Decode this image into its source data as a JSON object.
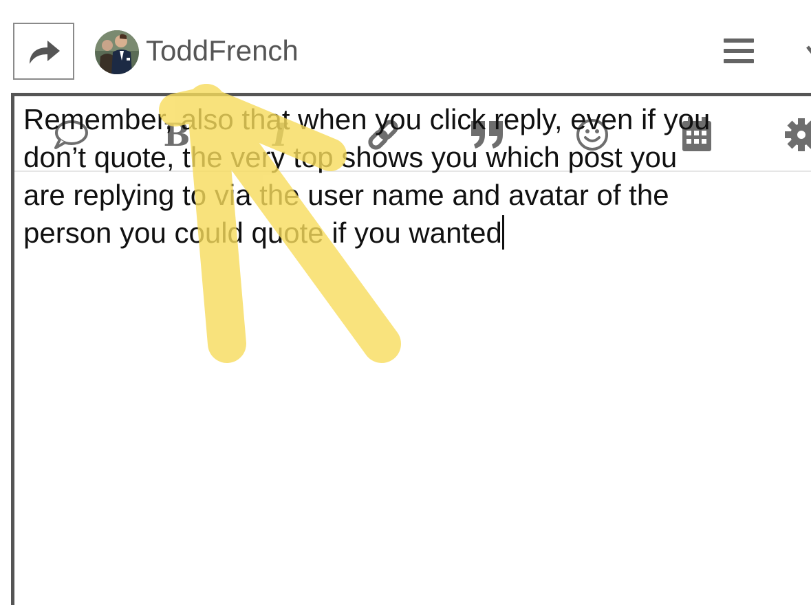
{
  "header": {
    "username": "ToddFrench",
    "reply_icon": "share-forward-icon",
    "menu_icon": "hamburger-menu-icon",
    "collapse_icon": "chevron-down-icon"
  },
  "toolbar": {
    "items": [
      {
        "name": "speech-bubble-icon"
      },
      {
        "name": "bold-icon",
        "glyph": "B"
      },
      {
        "name": "italic-icon",
        "glyph": "I"
      },
      {
        "name": "link-icon"
      },
      {
        "name": "quote-icon"
      },
      {
        "name": "emoji-icon"
      },
      {
        "name": "calendar-icon"
      },
      {
        "name": "gear-icon"
      }
    ]
  },
  "composer": {
    "lines": [
      "Remember, also that when you click reply, even if you",
      "don’t quote, the very top shows you which post you",
      "are replying to via the user name and avatar of the",
      "person you could quote if you wanted"
    ]
  },
  "colors": {
    "icon_gray": "#6e6e6e",
    "border": "#555555",
    "highlighter": "#f7dc5c"
  }
}
